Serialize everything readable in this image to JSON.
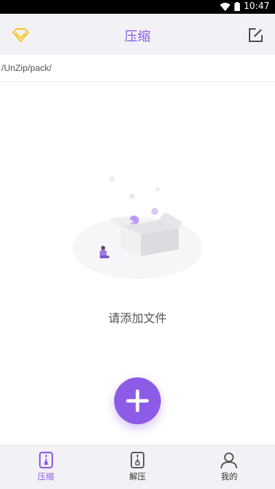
{
  "status_bar": {
    "time": "10:47"
  },
  "app_bar": {
    "title": "压缩",
    "left_icon": "diamond-icon",
    "right_icon": "edit-icon"
  },
  "path": {
    "text": "/UnZip/pack/"
  },
  "empty_state": {
    "message": "请添加文件",
    "illustration": "empty-box-illustration"
  },
  "fab": {
    "icon": "plus-icon"
  },
  "bottom_nav": {
    "items": [
      {
        "label": "压缩",
        "icon": "zip-file-icon",
        "active": true
      },
      {
        "label": "解压",
        "icon": "unzip-file-icon",
        "active": false
      },
      {
        "label": "我的",
        "icon": "user-icon",
        "active": false
      }
    ]
  },
  "colors": {
    "accent": "#8c5ce6",
    "vip": "#f5c518",
    "bar_bg": "#f2f2f6"
  }
}
